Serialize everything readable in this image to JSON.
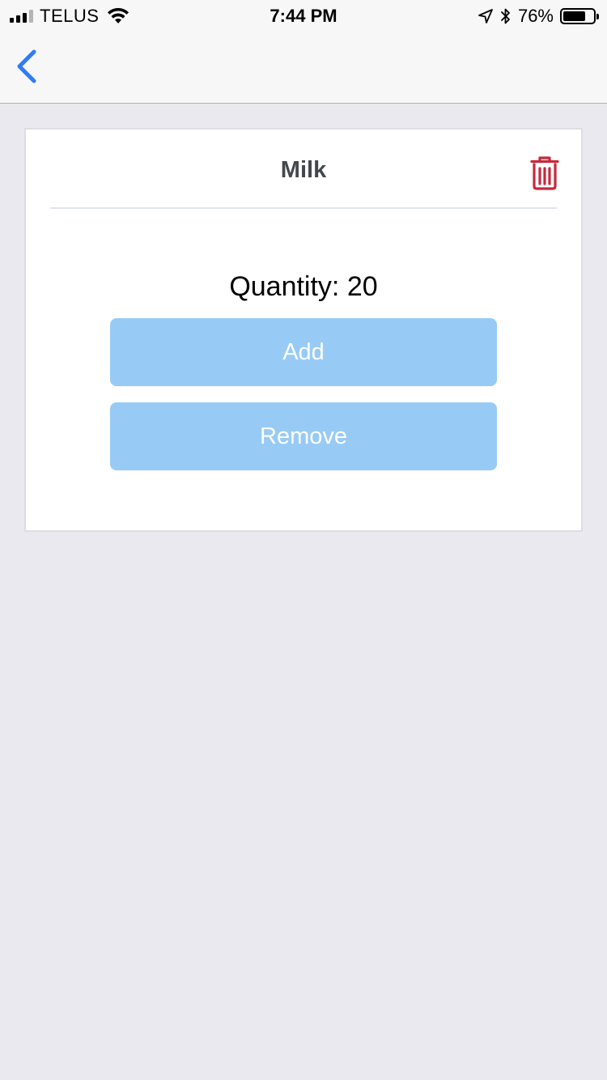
{
  "status_bar": {
    "carrier": "TELUS",
    "time": "7:44 PM",
    "battery_percent": "76%",
    "battery_level": 0.76,
    "icons": [
      "signal-icon",
      "wifi-icon",
      "location-arrow-icon",
      "bluetooth-icon",
      "battery-icon"
    ]
  },
  "nav": {
    "back_icon": "chevron-left-icon",
    "accent_color": "#2F7CF6"
  },
  "item": {
    "name": "Milk",
    "quantity_label": "Quantity:",
    "quantity_value": "20",
    "delete_icon": "trash-icon",
    "delete_color": "#C8283C"
  },
  "actions": {
    "add_label": "Add",
    "remove_label": "Remove",
    "button_color": "#97CBF5"
  }
}
